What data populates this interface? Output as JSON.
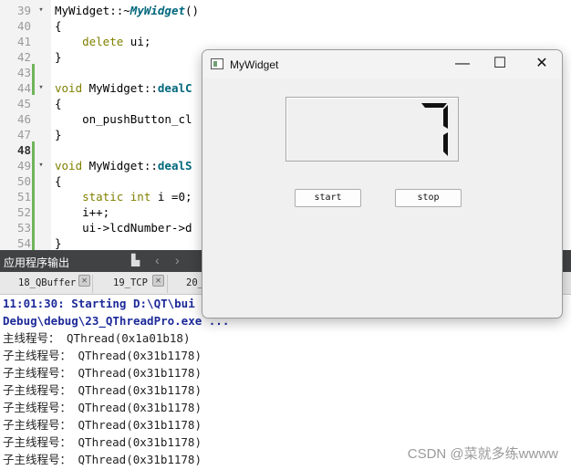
{
  "editor": {
    "lines": [
      {
        "num": "39",
        "parts": [
          [
            "pl",
            "MyWidget::~"
          ],
          [
            "fn",
            "MyWidget"
          ],
          [
            "pl",
            "()"
          ]
        ],
        "fold": "▾"
      },
      {
        "num": "40",
        "parts": [
          [
            "pl",
            "{"
          ]
        ]
      },
      {
        "num": "41",
        "parts": [
          [
            "kw",
            "    delete"
          ],
          [
            "pl",
            " ui;"
          ]
        ]
      },
      {
        "num": "42",
        "parts": [
          [
            "pl",
            "}"
          ]
        ]
      },
      {
        "num": "43",
        "parts": []
      },
      {
        "num": "44",
        "parts": [
          [
            "kw",
            "void"
          ],
          [
            "pl",
            " MyWidget::"
          ],
          [
            "fnb",
            "dealC"
          ]
        ],
        "fold": "▾"
      },
      {
        "num": "45",
        "parts": [
          [
            "pl",
            "{"
          ]
        ]
      },
      {
        "num": "46",
        "parts": [
          [
            "pl",
            "    on_pushButton_cl"
          ]
        ]
      },
      {
        "num": "47",
        "parts": [
          [
            "pl",
            "}"
          ]
        ]
      },
      {
        "num": "48",
        "parts": [],
        "current": true
      },
      {
        "num": "49",
        "parts": [
          [
            "kw",
            "void"
          ],
          [
            "pl",
            " MyWidget::"
          ],
          [
            "fnb",
            "dealS"
          ]
        ],
        "fold": "▾"
      },
      {
        "num": "50",
        "parts": [
          [
            "pl",
            "{"
          ]
        ]
      },
      {
        "num": "51",
        "parts": [
          [
            "kw",
            "    static int"
          ],
          [
            "pl",
            " i =0;"
          ]
        ]
      },
      {
        "num": "52",
        "parts": [
          [
            "pl",
            "    i++;"
          ]
        ]
      },
      {
        "num": "53",
        "parts": [
          [
            "pl",
            "    ui->lcdNumber->d"
          ]
        ]
      },
      {
        "num": "54",
        "parts": [
          [
            "pl",
            "}"
          ]
        ]
      }
    ]
  },
  "pane": {
    "title": "应用程序输出",
    "tabs": [
      "18_QBuffer",
      "19_TCP",
      "20_"
    ],
    "output": [
      {
        "text": "11:01:30: Starting D:\\QT\\bui",
        "blue": true
      },
      {
        "text": "Debug\\debug\\23_QThreadPro.exe ...",
        "blue": true
      },
      {
        "text": "主线程号： QThread(0x1a01b18)"
      },
      {
        "text": "子主线程号： QThread(0x31b1178)"
      },
      {
        "text": "子主线程号： QThread(0x31b1178)"
      },
      {
        "text": "子主线程号： QThread(0x31b1178)"
      },
      {
        "text": "子主线程号： QThread(0x31b1178)"
      },
      {
        "text": "子主线程号： QThread(0x31b1178)"
      },
      {
        "text": "子主线程号： QThread(0x31b1178)"
      },
      {
        "text": "子主线程号： QThread(0x31b1178)"
      }
    ]
  },
  "window": {
    "title": "MyWidget",
    "minimize_glyph": "—",
    "maximize_glyph": "☐",
    "close_glyph": "✕",
    "lcd_value": "7",
    "start_label": "start",
    "stop_label": "stop"
  },
  "watermark": "CSDN @菜就多练wwww",
  "colors": {
    "keyword": "#808000",
    "function": "#00677c",
    "output_blue": "#1d2a99",
    "pane_bar": "#404244"
  }
}
